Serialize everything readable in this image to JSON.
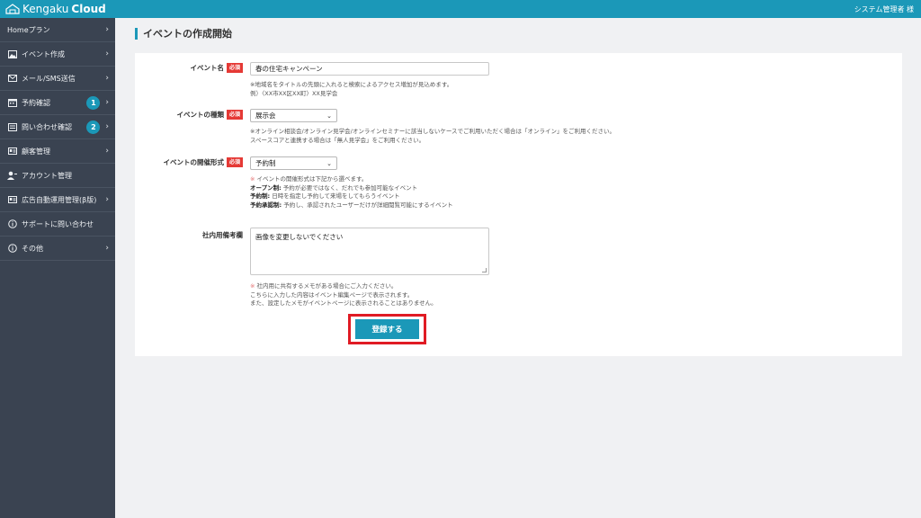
{
  "header": {
    "logo_light": "Kengaku",
    "logo_bold": "Cloud",
    "user": "システム管理者 様",
    "brand_color": "#1b98b8"
  },
  "sidebar": {
    "items": [
      {
        "label": "Homeプラン",
        "icon": "none",
        "chevron": true
      },
      {
        "label": "イベント作成",
        "icon": "image-icon",
        "chevron": true
      },
      {
        "label": "メール/SMS送信",
        "icon": "mail-icon",
        "chevron": true
      },
      {
        "label": "予約確認",
        "icon": "calendar-icon",
        "badge": "1",
        "chevron": true
      },
      {
        "label": "問い合わせ確認",
        "icon": "inbox-icon",
        "badge": "2",
        "chevron": true
      },
      {
        "label": "顧客管理",
        "icon": "id-card-icon",
        "chevron": true
      },
      {
        "label": "アカウント管理",
        "icon": "user-icon",
        "chevron": false
      },
      {
        "label": "広告自動運用管理(β版)",
        "icon": "id-card-icon",
        "chevron": true
      },
      {
        "label": "サポートに問い合わせ",
        "icon": "info-icon",
        "chevron": false
      },
      {
        "label": "その他",
        "icon": "info-icon",
        "chevron": true
      }
    ]
  },
  "page": {
    "title": "イベントの作成開始"
  },
  "form": {
    "required_label": "必須",
    "event_name": {
      "label": "イベント名",
      "value": "春の住宅キャンペーン",
      "help": [
        "※地域名をタイトルの先頭に入れると検索によるアクセス増加が見込めます。",
        "例）〈XX市XX区XX町〉XX見学会"
      ]
    },
    "event_type": {
      "label": "イベントの種類",
      "value": "展示会",
      "help": [
        "※オンライン相談会/オンライン見学会/オンラインセミナーに該当しないケースでご利用いただく場合は「オンライン」をご利用ください。",
        "スペースコアと連携する場合は「無人見学会」をご利用ください。"
      ]
    },
    "event_format": {
      "label": "イベントの開催形式",
      "value": "予約制",
      "help_intro": "イベントの開催形式は下記から選べます。",
      "help_lines": [
        {
          "term": "オープン制:",
          "desc": "予約が必要ではなく、だれでも参加可能なイベント"
        },
        {
          "term": "予約制:",
          "desc": "日時を指定し予約して来場をしてもらうイベント"
        },
        {
          "term": "予約承認制:",
          "desc": "予約し、承認されたユーザーだけが詳細閲覧可能にするイベント"
        }
      ]
    },
    "memo": {
      "label": "社内用備考欄",
      "value": "画像を変更しないでください",
      "help": [
        "社内用に共有するメモがある場合にご入力ください。",
        "こちらに入力した内容はイベント編集ページで表示されます。",
        "また、設定したメモがイベントページに表示されることはありません。"
      ]
    },
    "submit_label": "登録する"
  }
}
